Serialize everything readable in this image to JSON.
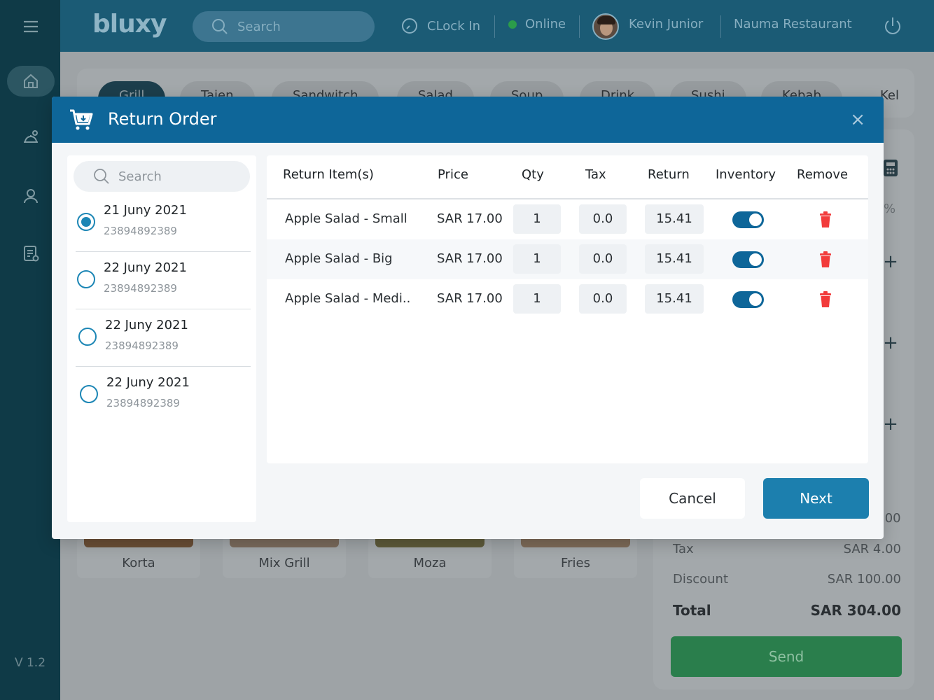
{
  "app": {
    "logo": "bluxy",
    "version": "V 1.2",
    "search_placeholder": "Search",
    "clock_in": "CLock In",
    "status": "Online",
    "user_name": "Kevin Junior",
    "restaurant": "Nauma Restaurant"
  },
  "categories": [
    "Grill",
    "Tajen",
    "Sandwitch",
    "Salad",
    "Soup",
    "Drink",
    "Sushi",
    "Kebab",
    "Kel"
  ],
  "foods": [
    "Korta",
    "Mix Grill",
    "Moza",
    "Fries"
  ],
  "summary": {
    "partial_amount": ".00",
    "tax_label": "Tax",
    "tax_value": "SAR 4.00",
    "discount_label": "Discount",
    "discount_value": "SAR 100.00",
    "total_label": "Total",
    "total_value": "SAR 304.00",
    "send_label": "Send",
    "percent_symbol": "%"
  },
  "modal": {
    "title": "Return Order",
    "close": "×",
    "search_placeholder": "Search",
    "orders": [
      {
        "date": "21 Juny 2021",
        "number": "23894892389",
        "selected": true
      },
      {
        "date": "22 Juny 2021",
        "number": "23894892389",
        "selected": false
      },
      {
        "date": "22 Juny 2021",
        "number": "23894892389",
        "selected": false
      },
      {
        "date": "22 Juny 2021",
        "number": "23894892389",
        "selected": false
      }
    ],
    "headers": {
      "item": "Return Item(s)",
      "price": "Price",
      "qty": "Qty",
      "tax": "Tax",
      "return": "Return",
      "inventory": "Inventory",
      "remove": "Remove"
    },
    "items": [
      {
        "name": "Apple Salad - Small",
        "price": "SAR 17.00",
        "qty": "1",
        "tax": "0.0",
        "return": "15.41",
        "inventory": true
      },
      {
        "name": "Apple Salad - Big",
        "price": "SAR 17.00",
        "qty": "1",
        "tax": "0.0",
        "return": "15.41",
        "inventory": true
      },
      {
        "name": "Apple Salad - Medi..",
        "price": "SAR 17.00",
        "qty": "1",
        "tax": "0.0",
        "return": "15.41",
        "inventory": true
      }
    ],
    "cancel_label": "Cancel",
    "next_label": "Next"
  },
  "colors": {
    "primary": "#0e6699",
    "accent": "#1c7fae",
    "danger": "#f23b3b",
    "success": "#2a7e4c"
  }
}
